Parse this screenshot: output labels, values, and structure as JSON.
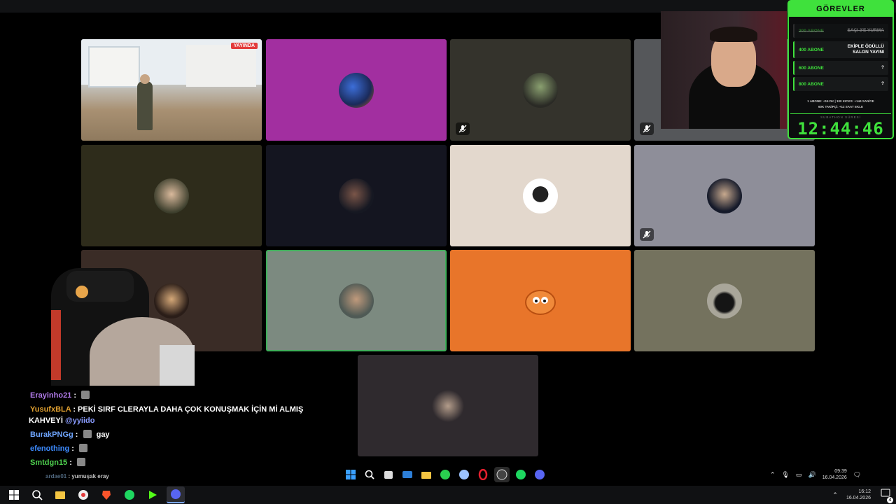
{
  "tiles": {
    "live_badge": "YAYINDA"
  },
  "goals": {
    "title": "GÖREVLER",
    "tasks": [
      {
        "level": "200 ABONE",
        "reward": "SAÇI 3'E VURMA",
        "done": true
      },
      {
        "level": "400 ABONE",
        "reward": "EKİPLE ÖDÜLLÜ SALON YAYINI",
        "done": false
      },
      {
        "level": "600 ABONE",
        "reward": "?",
        "done": false
      },
      {
        "level": "800 ABONE",
        "reward": "?",
        "done": false
      }
    ],
    "rules_line1": "1 ABONE: +15 DK | 100 KICKS: +144 SANİYE",
    "rules_line2": "60K TAKİPÇİ: +12 SAAT EKLE",
    "timer_label": "SUBATHON SÜRESİ",
    "timer": "12:44:46"
  },
  "chat": {
    "messages": [
      {
        "user": "Erayinho21",
        "color": "#b07ae8",
        "text": ""
      },
      {
        "user": "YusufxBLA",
        "color": "#e0a030",
        "text": "PEKİ SIRF CLERAYLA DAHA ÇOK KONUŞMAK İÇİN Mİ ALMIŞ"
      },
      {
        "user": "",
        "color": "#ffffff",
        "text": "KAHVEYİ",
        "mention": "@yyiido"
      },
      {
        "user": "BurakPNGg",
        "color": "#6fa6ff",
        "text": "gay"
      },
      {
        "user": "efenothing",
        "color": "#3d8bff",
        "text": ""
      },
      {
        "user": "Smtdgn15",
        "color": "#4fd34f",
        "text": ""
      },
      {
        "user": "ardae01",
        "color": "#6a8aa8",
        "text": "yumuşak eray"
      }
    ]
  },
  "systray": {
    "time": "09:39",
    "date": "16.04.2026"
  },
  "taskbar": {
    "time": "16:12",
    "date": "16.04.2026",
    "notif_count": "4"
  }
}
